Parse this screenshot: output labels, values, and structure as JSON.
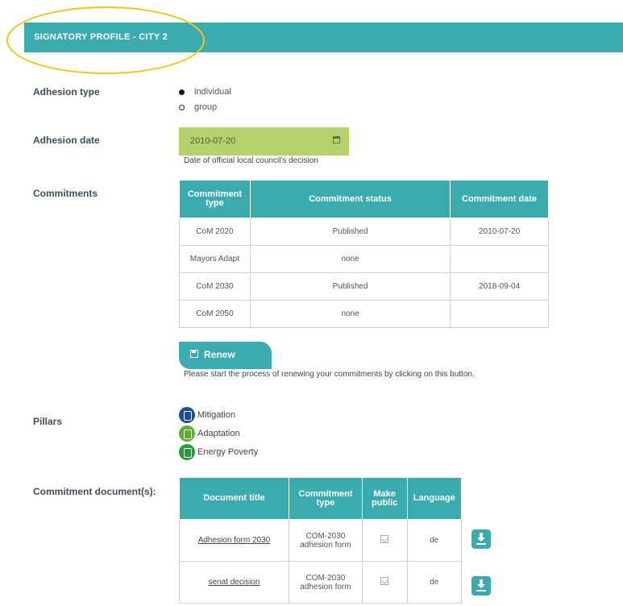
{
  "header": {
    "title": "SIGNATORY PROFILE - CITY 2"
  },
  "adhesion_type": {
    "label": "Adhesion type",
    "options": [
      {
        "label": "individual",
        "selected": true
      },
      {
        "label": "group",
        "selected": false
      }
    ]
  },
  "adhesion_date": {
    "label": "Adhesion date",
    "value": "2010-07-20",
    "hint": "Date of official local council's decision",
    "icon": "calendar-icon",
    "bg_color": "#b5d16c"
  },
  "commitments": {
    "label": "Commitments",
    "columns": [
      "Commitment type",
      "Commitment status",
      "Commitment date"
    ],
    "rows": [
      {
        "type": "CoM 2020",
        "status": "Published",
        "date": "2010-07-20"
      },
      {
        "type": "Mayors Adapt",
        "status": "none",
        "date": ""
      },
      {
        "type": "CoM 2030",
        "status": "Published",
        "date": "2018-09-04"
      },
      {
        "type": "CoM 2050",
        "status": "none",
        "date": ""
      }
    ]
  },
  "renew": {
    "button_label": "Renew",
    "icon": "floppy-disk-icon",
    "hint": "Please start the process of renewing your commitments by clicking on this button."
  },
  "pillars": {
    "label": "Pillars",
    "items": [
      {
        "label": "Mitigation",
        "icon": "mitigation-icon",
        "color": "#1d4f8f"
      },
      {
        "label": "Adaptation",
        "icon": "adaptation-icon",
        "color": "#5bb030"
      },
      {
        "label": "Energy Poverty",
        "icon": "energy-poverty-icon",
        "color": "#2a9a3c"
      }
    ]
  },
  "documents": {
    "label": "Commitment document(s):",
    "columns": [
      "Document title",
      "Commitment type",
      "Make public",
      "Language"
    ],
    "rows": [
      {
        "title": "Adhesion form 2030",
        "type": "COM-2030 adhesion form",
        "make_public": true,
        "language": "de"
      },
      {
        "title": "senat decision",
        "type": "COM-2030 adhesion form",
        "make_public": true,
        "language": "de"
      }
    ]
  },
  "theme": {
    "accent": "#3aacaf",
    "highlight": "#f5c518"
  }
}
